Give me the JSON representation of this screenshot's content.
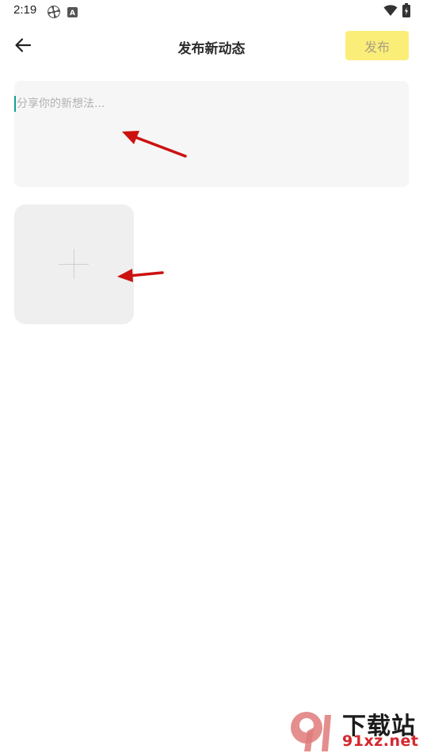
{
  "status_bar": {
    "time": "2:19",
    "icons_left": [
      "pinwheel-icon",
      "a-box-icon"
    ],
    "icons_right": [
      "wifi-icon",
      "battery-icon"
    ]
  },
  "header": {
    "back_icon": "arrow-left-icon",
    "title": "发布新动态",
    "publish_label": "发布"
  },
  "composer": {
    "placeholder": "分享你的新想法..."
  },
  "media": {
    "add_icon": "plus-icon"
  },
  "watermark": {
    "brand_cn": "下载站",
    "url": "91xz.net"
  },
  "colors": {
    "publish_bg": "#fbee78",
    "cursor": "#12a091",
    "arrow": "#cc1111",
    "watermark_red": "#d6262e"
  }
}
